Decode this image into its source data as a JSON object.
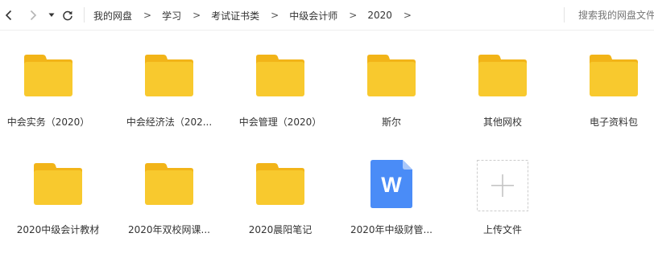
{
  "toolbar": {
    "back_icon": "chevron-left-icon",
    "forward_icon": "chevron-right-icon",
    "history_icon": "caret-down-icon",
    "refresh_icon": "refresh-icon",
    "breadcrumbs": [
      "我的网盘",
      "学习",
      "考试证书类",
      "中级会计师",
      "2020"
    ],
    "separator": ">",
    "search_placeholder": "搜索我的网盘文件"
  },
  "colors": {
    "folder_tab": "#F2B418",
    "folder_body": "#F8C92E",
    "word_doc": "#4A8CF7",
    "word_fold": "#A9C8FB",
    "upload_border": "#CCCCCC",
    "upload_plus": "#C4C4C4"
  },
  "files": [
    {
      "type": "folder",
      "icon": "folder-icon",
      "name": "中会实务（2020）"
    },
    {
      "type": "folder",
      "icon": "folder-icon",
      "name": "中会经济法（202..."
    },
    {
      "type": "folder",
      "icon": "folder-icon",
      "name": "中会管理（2020）"
    },
    {
      "type": "folder",
      "icon": "folder-icon",
      "name": "斯尔"
    },
    {
      "type": "folder",
      "icon": "folder-icon",
      "name": "其他网校"
    },
    {
      "type": "folder",
      "icon": "folder-icon",
      "name": "电子资料包"
    },
    {
      "type": "folder",
      "icon": "folder-icon",
      "name": "2020中级会计教材"
    },
    {
      "type": "folder",
      "icon": "folder-icon",
      "name": "2020年双校网课..."
    },
    {
      "type": "folder",
      "icon": "folder-icon",
      "name": "2020晨阳笔记"
    },
    {
      "type": "word",
      "icon": "word-doc-icon",
      "name": "2020年中级财管...",
      "letter": "W"
    }
  ],
  "upload": {
    "icon": "plus-icon",
    "label": "上传文件"
  }
}
